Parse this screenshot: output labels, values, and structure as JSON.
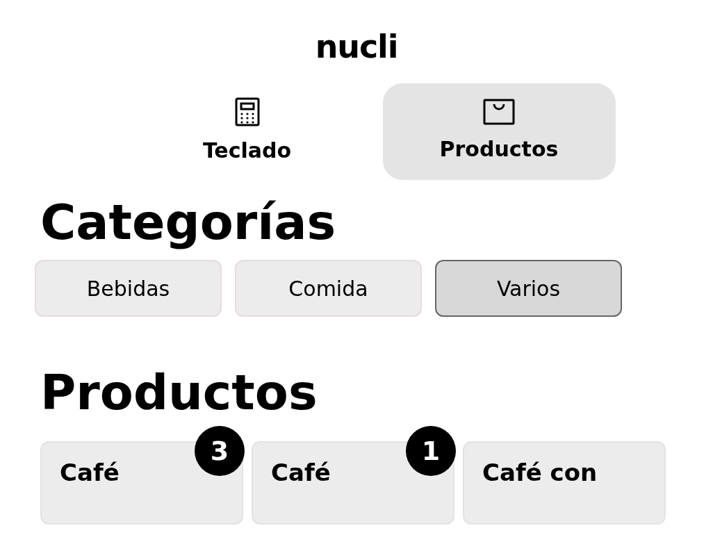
{
  "logo": "nucli",
  "tabs": [
    {
      "label": "Teclado",
      "selected": false
    },
    {
      "label": "Productos",
      "selected": true
    }
  ],
  "categories": {
    "title": "Categorías",
    "items": [
      {
        "label": "Bebidas",
        "selected": false
      },
      {
        "label": "Comida",
        "selected": false
      },
      {
        "label": "Varios",
        "selected": true
      }
    ]
  },
  "products": {
    "title": "Productos",
    "items": [
      {
        "name": "Café",
        "count": "3"
      },
      {
        "name": "Café",
        "count": "1"
      },
      {
        "name": "Café con"
      }
    ]
  }
}
